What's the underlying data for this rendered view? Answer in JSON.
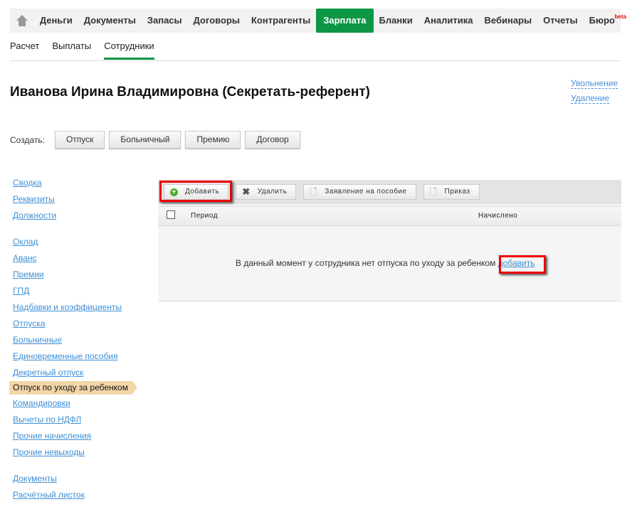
{
  "nav": {
    "items": [
      "Деньги",
      "Документы",
      "Запасы",
      "Договоры",
      "Контрагенты",
      "Зарплата",
      "Бланки",
      "Аналитика",
      "Вебинары",
      "Отчеты",
      "Бюро"
    ],
    "active": "Зарплата",
    "beta": "beta",
    "accent": "#0e9647"
  },
  "subnav": {
    "items": [
      "Расчет",
      "Выплаты",
      "Сотрудники"
    ],
    "active": "Сотрудники"
  },
  "title": "Иванова Ирина Владимировна (Секретать-референт)",
  "actions": {
    "dismiss": "Увольнение",
    "delete": "Удаление"
  },
  "create": {
    "label": "Создать:",
    "buttons": [
      "Отпуск",
      "Больничный",
      "Премию",
      "Договор"
    ]
  },
  "sidebar": {
    "groups": [
      [
        "Сводка",
        "Реквизиты",
        "Должности"
      ],
      [
        "Оклад",
        "Аванс",
        "Премии",
        "ГПД",
        "Надбавки и коэффициенты",
        "Отпуска",
        "Больничные",
        "Единовременные пособия",
        "Декретный отпуск",
        "Отпуск по уходу за ребенком",
        "Командировки",
        "Вычеты по НДФЛ",
        "Прочие начисления",
        "Прочие невыходы"
      ],
      [
        "Документы",
        "Расчётный листок"
      ]
    ],
    "active": "Отпуск по уходу за ребенком"
  },
  "toolbar": {
    "add": "Добавить",
    "remove": "Удалить",
    "application": "Заявление на пособие",
    "order": "Приказ"
  },
  "table": {
    "columns": [
      "Период",
      "Начислено"
    ]
  },
  "empty": {
    "text": "В данный момент у сотрудника нет отпуска по уходу за ребенком",
    "link": "добавить"
  }
}
